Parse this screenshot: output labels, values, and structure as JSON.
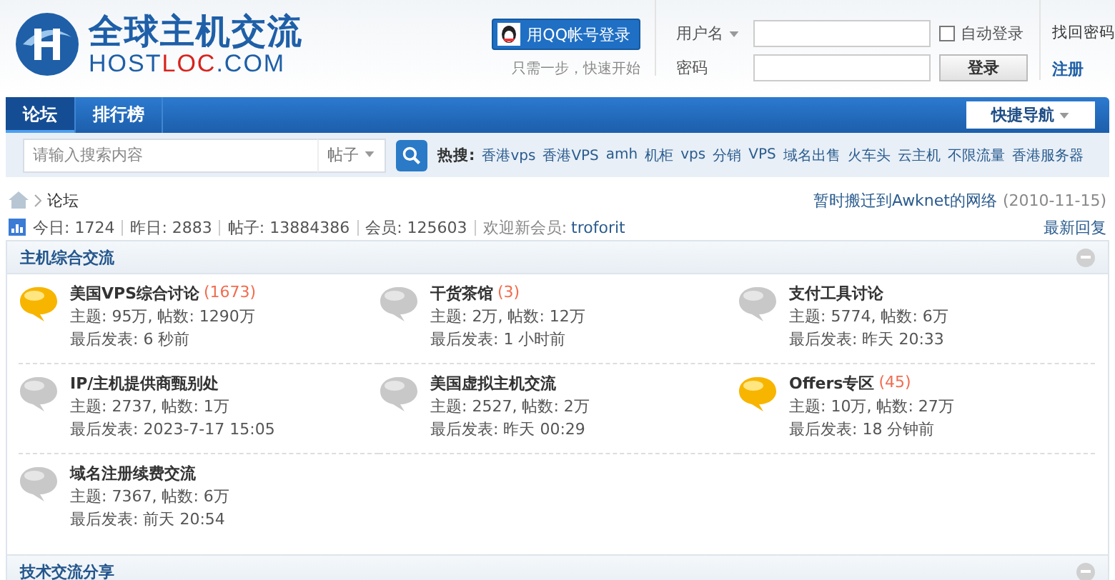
{
  "logo": {
    "title": "全球主机交流",
    "domain_parts": [
      {
        "text": "HOST",
        "accent": false
      },
      {
        "text": "LOC",
        "accent": true
      },
      {
        "text": ".COM",
        "accent": false
      }
    ]
  },
  "qq_login": {
    "button": "用QQ帐号登录",
    "hint": "只需一步，快速开始"
  },
  "login": {
    "username_label": "用户名",
    "password_label": "密码",
    "auto_login": {
      "label": "自动登录",
      "checked": false
    },
    "submit": "登录",
    "forgot": "找回密码",
    "register": "注册"
  },
  "nav": {
    "tabs": [
      {
        "label": "论坛",
        "selected": true
      },
      {
        "label": "排行榜",
        "selected": false
      }
    ],
    "quick_nav": "快捷导航"
  },
  "search": {
    "placeholder": "请输入搜索内容",
    "scope": "帖子",
    "hot_label": "热搜:",
    "hot_terms": [
      "香港vps",
      "香港VPS",
      "amh",
      "机柜",
      "vps",
      "分销",
      "VPS",
      "域名出售",
      "火车头",
      "云主机",
      "不限流量",
      "香港服务器"
    ]
  },
  "breadcrumb": [
    "论坛"
  ],
  "notice": {
    "text": "暂时搬迁到Awknet的网络",
    "date": "(2010-11-15)"
  },
  "stats": {
    "items": [
      "今日: 1724",
      "昨日: 2883",
      "帖子: 13884386",
      "会员: 125603"
    ],
    "welcome": "欢迎新会员:",
    "new_member": "troforit",
    "latest": "最新回复"
  },
  "sections": [
    {
      "title": "主机综合交流",
      "forums": [
        {
          "name": "美国VPS综合讨论",
          "new": true,
          "count": "(1673)",
          "stats": "主题: 95万, 帖数: 1290万",
          "last": "最后发表: 6 秒前"
        },
        {
          "name": "干货茶馆",
          "new": false,
          "count": "(3)",
          "stats": "主题: 2万, 帖数: 12万",
          "last": "最后发表: 1 小时前"
        },
        {
          "name": "支付工具讨论",
          "new": false,
          "stats": "主题: 5774, 帖数: 6万",
          "last": "最后发表: 昨天 20:33"
        },
        {
          "name": "IP/主机提供商甄别处",
          "new": false,
          "stats": "主题: 2737, 帖数: 1万",
          "last": "最后发表: 2023-7-17 15:05"
        },
        {
          "name": "美国虚拟主机交流",
          "new": false,
          "stats": "主题: 2527, 帖数: 2万",
          "last": "最后发表: 昨天 00:29"
        },
        {
          "name": "Offers专区",
          "new": true,
          "count": "(45)",
          "stats": "主题: 10万, 帖数: 27万",
          "last": "最后发表: 18 分钟前"
        },
        {
          "name": "域名注册续费交流",
          "new": false,
          "stats": "主题: 7367, 帖数: 6万",
          "last": "最后发表: 前天 20:54"
        }
      ]
    },
    {
      "title": "技术交流分享"
    }
  ]
}
